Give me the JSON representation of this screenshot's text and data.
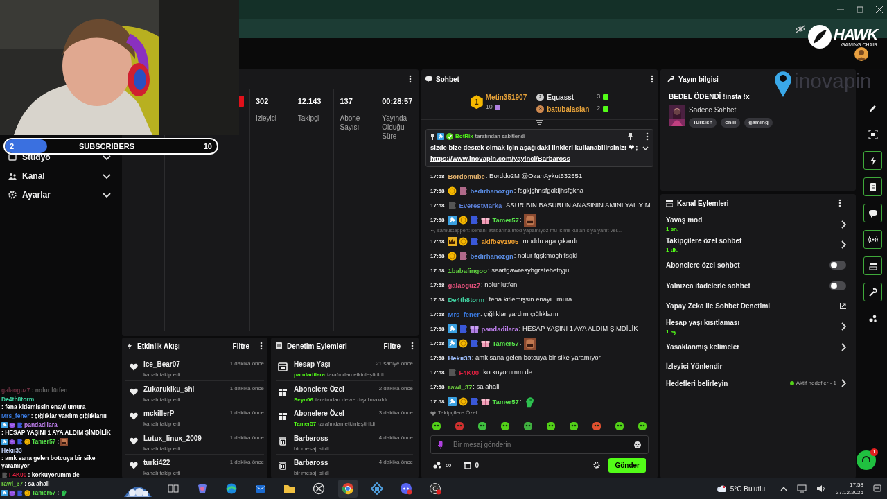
{
  "sub_goal": {
    "current": "2",
    "label": "SUBSCRIBERS",
    "target": "10",
    "level": 0.2
  },
  "overlay_logos": {
    "hawk": "HAWK",
    "hawk_sub": "GAMING CHAIR",
    "inovapin": "inovapin"
  },
  "sidebar": {
    "items": [
      {
        "label": "Stüdyo"
      },
      {
        "label": "Kanal"
      },
      {
        "label": "Ayarlar"
      }
    ]
  },
  "stats": [
    {
      "value": "302",
      "label": "İzleyici"
    },
    {
      "value": "12.143",
      "label": "Takipçi"
    },
    {
      "value": "137",
      "label": "Abone Sayısı"
    },
    {
      "value": "00:28:57",
      "label": "Yayında Olduğu Süre"
    }
  ],
  "activity": {
    "title": "Etkinlik Akışı",
    "filter": "Filtre",
    "items": [
      {
        "user": "Ice_Bear07",
        "action": "kanalı takip etti",
        "time": "1 dakika önce"
      },
      {
        "user": "Zukarukiku_shi",
        "action": "kanalı takip etti",
        "time": "1 dakika önce"
      },
      {
        "user": "mckillerP",
        "action": "kanalı takip etti",
        "time": "1 dakika önce"
      },
      {
        "user": "Lutux_linux_2009",
        "action": "kanalı takip etti",
        "time": "1 dakika önce"
      },
      {
        "user": "turki422",
        "action": "kanalı takip etti",
        "time": "1 dakika önce"
      }
    ]
  },
  "moderation": {
    "title": "Denetim Eylemleri",
    "filter": "Filtre",
    "items": [
      {
        "kind": "calendar",
        "title": "Hesap Yaşı",
        "by": "pandadilara",
        "action": "tarafından etkinleştirildi",
        "time": "21 saniye önce"
      },
      {
        "kind": "gift",
        "title": "Abonelere Özel",
        "by": "Seyo06",
        "action": "tarafından devre dışı bırakıldı",
        "time": "2 dakika önce"
      },
      {
        "kind": "gift",
        "title": "Abonelere Özel",
        "by": "Tamer57",
        "action": "tarafından etkinleştirildi",
        "time": "3 dakika önce"
      },
      {
        "kind": "trash",
        "title": "Barbaross",
        "action": "bir mesajı sildi",
        "time": "4 dakika önce"
      },
      {
        "kind": "trash",
        "title": "Barbaross",
        "action": "bir mesajı sildi",
        "time": "4 dakika önce"
      }
    ]
  },
  "chat": {
    "title": "Sohbet",
    "top_gifters": [
      {
        "rank": "1",
        "name": "Metin351907",
        "count": "10",
        "color": "#e8a33a"
      },
      {
        "rank": "2",
        "name": "Equasst",
        "count": "3",
        "color": "#e5e5e5"
      },
      {
        "rank": "3",
        "name": "batubalaslan",
        "count": "2",
        "color": "#e8a33a"
      }
    ],
    "pinned": {
      "by": "BotRix",
      "by_suffix": "tarafından sabitlendi",
      "text": "sizde bize destek olmak için aşağıdaki linkleri kullanabilirsiniz! ❤ ;",
      "link": "https://www.inovapin.com/yayinci/Barbaross"
    },
    "messages": [
      {
        "time": "17:58",
        "user": "Bordomube",
        "color": "#e6b46e",
        "text": ": Borddo2M @OzanAykut532551"
      },
      {
        "time": "17:58",
        "badges": [
          {
            "kind": "sub"
          },
          {
            "kind": "tier_pink"
          }
        ],
        "user": "bedirhanozgn",
        "color": "#5b8ee6",
        "text": ": fsgkjşhnsfgokljhsfgkha"
      },
      {
        "time": "17:58",
        "badges": [
          {
            "kind": "tier_grey"
          }
        ],
        "user": "EverestMarka",
        "color": "#5b7fd6",
        "text": ": ASUR BİN BASURUN ANASININ AMINI YALİYİM"
      },
      {
        "time": "17:58",
        "badges": [
          {
            "kind": "mod"
          },
          {
            "kind": "sub"
          },
          {
            "kind": "tier_blue"
          },
          {
            "kind": "gift"
          }
        ],
        "user": "Tamer57",
        "color": "#56e04a",
        "text": ":",
        "emote": {
          "kind": "face"
        }
      },
      {
        "time": "17:58",
        "reply": "samustappen: kenanı atabarına mod yapamıyoz mu isimli kullanıcıya yanıt ver...",
        "badges": [
          {
            "kind": "crown"
          },
          {
            "kind": "sub"
          },
          {
            "kind": "tier_blue"
          }
        ],
        "user": "akifbey1905",
        "color": "#f0a030",
        "text": ": moddu aga çıkardı"
      },
      {
        "time": "17:58",
        "badges": [
          {
            "kind": "sub"
          },
          {
            "kind": "tier_pink"
          }
        ],
        "user": "bedirhanozgn",
        "color": "#5b8ee6",
        "text": ": nolur fgşkmöçhjfsgkl"
      },
      {
        "time": "17:58",
        "user": "1babafingoo",
        "color": "#60d040",
        "text": ": seartgawresyhgratehetryju"
      },
      {
        "time": "17:58",
        "user": "galaoguz7",
        "color": "#e0507a",
        "text": ": nolur lütfen"
      },
      {
        "time": "17:58",
        "user": "De4th8torm",
        "color": "#40d0a0",
        "text": ": fena kitlemişsin enayi umura"
      },
      {
        "time": "17:58",
        "user": "Mrs_fener",
        "color": "#3a7ae0",
        "text": ": çığlıklar yardım çığlıklarııı"
      },
      {
        "time": "17:58",
        "badges": [
          {
            "kind": "mod"
          },
          {
            "kind": "tier_blue"
          },
          {
            "kind": "gift_purple"
          }
        ],
        "user": "pandadilara",
        "color": "#c080f0",
        "text": ": HESAP YAŞINI 1 AYA ALDIM ŞİMDİLİK"
      },
      {
        "time": "17:58",
        "badges": [
          {
            "kind": "mod"
          },
          {
            "kind": "sub"
          },
          {
            "kind": "tier_blue"
          },
          {
            "kind": "gift"
          }
        ],
        "user": "Tamer57",
        "color": "#56e04a",
        "text": ":",
        "emote": {
          "kind": "face"
        }
      },
      {
        "time": "17:58",
        "user": "Hekii33",
        "color": "#a0c0ff",
        "text": ": amk sana gelen botcuya bir sike yaramıyor"
      },
      {
        "time": "17:58",
        "badges": [
          {
            "kind": "tier_grey"
          }
        ],
        "user": "F4K00",
        "color": "#e02040",
        "text": ": korkuyorumm de"
      },
      {
        "time": "17:58",
        "user": "rawl_37",
        "color": "#70d040",
        "text": ": sa ahali"
      },
      {
        "time": "17:58",
        "badges": [
          {
            "kind": "mod"
          },
          {
            "kind": "sub"
          },
          {
            "kind": "tier_blue"
          },
          {
            "kind": "gift"
          }
        ],
        "user": "Tamer57",
        "color": "#56e04a",
        "text": ":",
        "emote": {
          "kind": "frog"
        }
      }
    ],
    "emote_label": "Takipçilere Özel",
    "input": {
      "placeholder": "Bir mesaj gönderin"
    },
    "points": "∞",
    "store_count": "0",
    "send": "Gönder"
  },
  "stream_info": {
    "title": "Yayın bilgisi",
    "stream_title": "BEDEL ÖDENDİ !insta !x",
    "category": "Sadece Sohbet",
    "tags": [
      "Turkish",
      "chill",
      "gaming"
    ]
  },
  "channel_actions": {
    "title": "Kanal Eylemleri",
    "items": [
      {
        "kind": "nav",
        "label": "Yavaş mod",
        "value": "1 sn."
      },
      {
        "kind": "nav",
        "label": "Takipçilere özel sohbet",
        "value": "1 dk."
      },
      {
        "kind": "toggle",
        "label": "Abonelere özel sohbet",
        "on": false
      },
      {
        "kind": "toggle",
        "label": "Yalnızca ifadelerle sohbet",
        "on": false
      },
      {
        "kind": "external",
        "label": "Yapay Zeka ile Sohbet Denetimi"
      },
      {
        "kind": "nav",
        "label": "Hesap yaşı kısıtlaması",
        "value": "1 ay"
      },
      {
        "kind": "nav",
        "label": "Yasaklanmış kelimeler"
      },
      {
        "kind": "plain",
        "label": "İzleyici Yönlendir"
      },
      {
        "kind": "goal",
        "label": "Hedefleri belirleyin",
        "status": "Aktif hedefler - 1"
      }
    ]
  },
  "overlay_chat": [
    {
      "user": "galaoguz7",
      "color": "#6a3040",
      "text": ": nolur lütfen",
      "faded": true
    },
    {
      "user": "De4th8torm",
      "color": "#40d0a0",
      "text": ": fena kitlemişsin enayi umura",
      "faded": false
    },
    {
      "user": "Mrs_fener",
      "color": "#3a7ae0",
      "text": ": çığlıklar yardım çığlıklarııı",
      "faded": false
    },
    {
      "user": "pandadilara",
      "color": "#c080f0",
      "badges": [
        {
          "kind": "mod"
        },
        {
          "kind": "cube"
        },
        {
          "kind": "tier_blue"
        }
      ],
      "text": ": HESAP YAŞINI 1 AYA ALDIM ŞİMDİLİK",
      "faded": false
    },
    {
      "user": "Tamer57",
      "color": "#56e04a",
      "badges": [
        {
          "kind": "mod"
        },
        {
          "kind": "cube"
        },
        {
          "kind": "tier_blue"
        },
        {
          "kind": "sub"
        }
      ],
      "text": ":",
      "emote": {
        "kind": "face"
      },
      "faded": false
    },
    {
      "user": "Hekii33",
      "color": "#c8d8ff",
      "text": ": amk sana gelen botcuya bir sike yaramıyor",
      "faded": false
    },
    {
      "user": "F4K00",
      "color": "#e02040",
      "badges": [
        {
          "kind": "tier_grey"
        }
      ],
      "text": ": korkuyorumm de",
      "faded": false
    },
    {
      "user": "rawl_37",
      "color": "#70d040",
      "text": ": sa ahali",
      "faded": false
    },
    {
      "user": "Tamer57",
      "color": "#56e04a",
      "badges": [
        {
          "kind": "mod"
        },
        {
          "kind": "cube"
        },
        {
          "kind": "tier_blue"
        },
        {
          "kind": "sub"
        }
      ],
      "text": ":",
      "emote": {
        "kind": "frog"
      },
      "faded": false
    }
  ],
  "support_badge": "1",
  "taskbar": {
    "weather": "5°C Bulutlu",
    "time": "17:58",
    "date": "27.12.2025"
  }
}
